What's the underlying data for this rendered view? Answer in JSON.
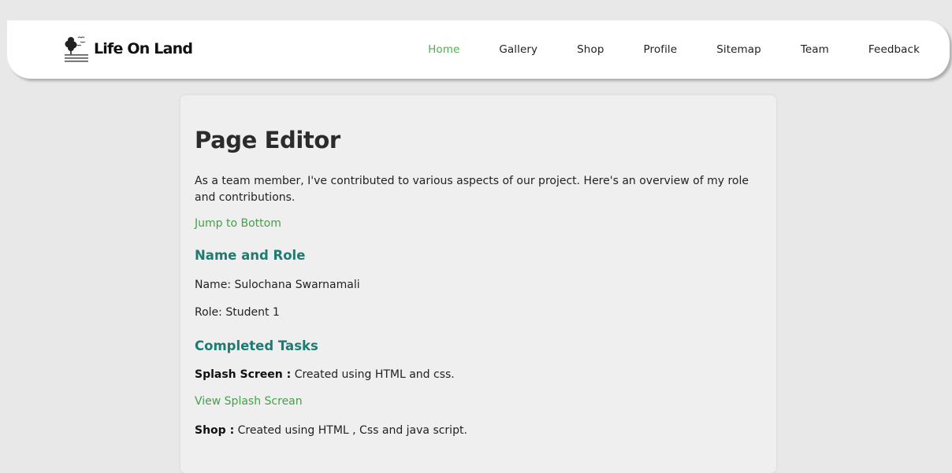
{
  "brand": {
    "name": "Life On Land",
    "logo_icon": "tree-bird-logo-icon"
  },
  "nav": {
    "items": [
      {
        "label": "Home",
        "active": true
      },
      {
        "label": "Gallery",
        "active": false
      },
      {
        "label": "Shop",
        "active": false
      },
      {
        "label": "Profile",
        "active": false
      },
      {
        "label": "Sitemap",
        "active": false
      },
      {
        "label": "Team",
        "active": false
      },
      {
        "label": "Feedback",
        "active": false
      }
    ]
  },
  "page": {
    "title": "Page Editor",
    "intro": "As a team member, I've contributed to various aspects of our project. Here's an overview of my role and contributions.",
    "jump_link": "Jump to Bottom",
    "name_role_heading": "Name and Role",
    "name_line": "Name: Sulochana Swarnamali",
    "role_line": "Role: Student 1",
    "tasks_heading": "Completed Tasks",
    "tasks": [
      {
        "title": "Splash Screen :",
        "description": " Created using HTML and css."
      },
      {
        "title": "Shop :",
        "description": " Created using HTML , Css and java script."
      }
    ],
    "splash_link": "View Splash Screan"
  },
  "colors": {
    "accent_green": "#4caf50",
    "link_green": "#45a049",
    "heading_teal": "#1f7a72",
    "background": "#e8e8e8",
    "card": "#efefef"
  }
}
